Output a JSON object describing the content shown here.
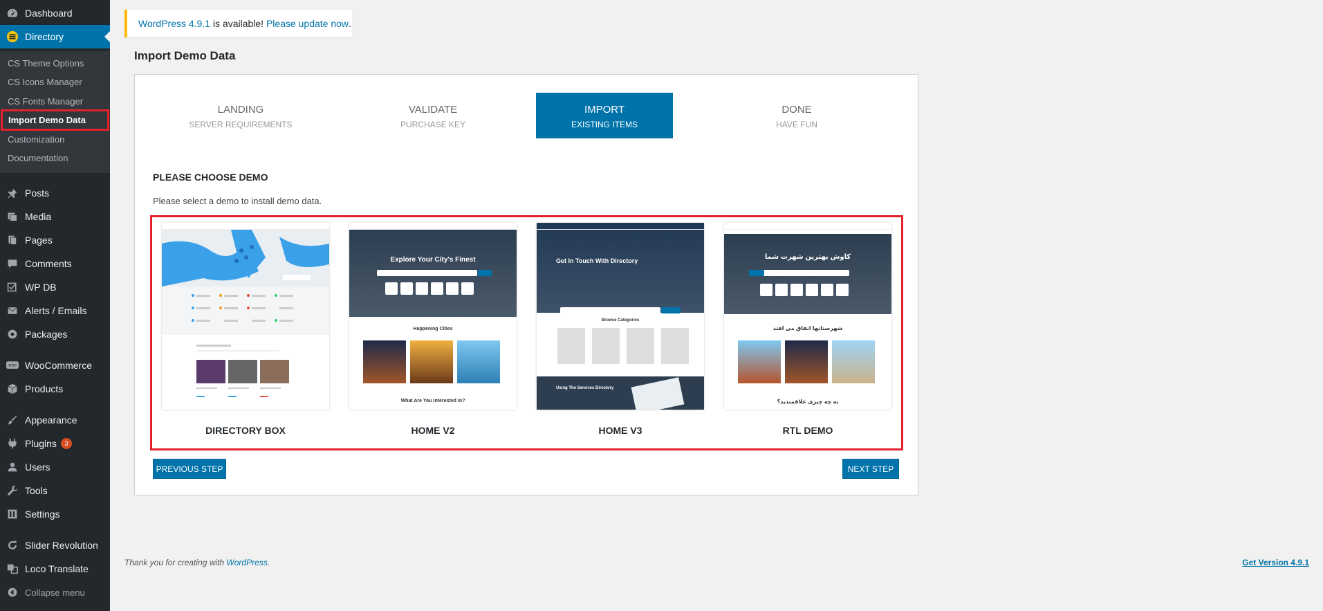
{
  "sidebar": {
    "top": [
      {
        "label": "Dashboard",
        "icon": "dashboard-icon"
      },
      {
        "label": "Directory",
        "icon": "directory-icon"
      }
    ],
    "submenu": [
      {
        "label": "CS Theme Options"
      },
      {
        "label": "CS Icons Manager"
      },
      {
        "label": "CS Fonts Manager"
      },
      {
        "label": "Import Demo Data"
      },
      {
        "label": "Customization"
      },
      {
        "label": "Documentation"
      }
    ],
    "items": [
      {
        "label": "Posts",
        "icon": "pin-icon"
      },
      {
        "label": "Media",
        "icon": "media-icon"
      },
      {
        "label": "Pages",
        "icon": "pages-icon"
      },
      {
        "label": "Comments",
        "icon": "comment-icon"
      },
      {
        "label": "WP DB",
        "icon": "checkbox-icon"
      },
      {
        "label": "Alerts / Emails",
        "icon": "email-icon"
      },
      {
        "label": "Packages",
        "icon": "packages-icon"
      },
      {
        "label": "WooCommerce",
        "icon": "woocommerce-icon"
      },
      {
        "label": "Products",
        "icon": "products-icon"
      },
      {
        "label": "Appearance",
        "icon": "brush-icon"
      },
      {
        "label": "Plugins",
        "icon": "plugin-icon",
        "badge": "3"
      },
      {
        "label": "Users",
        "icon": "user-icon"
      },
      {
        "label": "Tools",
        "icon": "wrench-icon"
      },
      {
        "label": "Settings",
        "icon": "settings-icon"
      },
      {
        "label": "Slider Revolution",
        "icon": "refresh-icon"
      },
      {
        "label": "Loco Translate",
        "icon": "translate-icon"
      }
    ],
    "collapse_label": "Collapse menu"
  },
  "notice": {
    "link1": "WordPress 4.9.1",
    "text": " is available! ",
    "link2": "Please update now",
    "end": "."
  },
  "page_title": "Import Demo Data",
  "steps": [
    {
      "title": "LANDING",
      "sub": "SERVER REQUIREMENTS"
    },
    {
      "title": "VALIDATE",
      "sub": "PURCHASE KEY"
    },
    {
      "title": "IMPORT",
      "sub": "EXISTING ITEMS"
    },
    {
      "title": "DONE",
      "sub": "HAVE FUN"
    }
  ],
  "choose": {
    "title": "PLEASE CHOOSE DEMO",
    "desc": "Please select a demo to install demo data."
  },
  "demos": [
    {
      "label": "DIRECTORY BOX"
    },
    {
      "label": "HOME V2",
      "hero": "Explore Your City's Finest",
      "section": "Happening Cities",
      "footer": "What Are You Interested In?"
    },
    {
      "label": "HOME V3",
      "hero": "Get In Touch With Directory",
      "section": "Browse Categories",
      "footer": "Using The Services Directory"
    },
    {
      "label": "RTL DEMO",
      "hero": "کاوش بهترین شهرت شما",
      "section": "شهرستانها اتفاق می افتد",
      "footer": "به چه چیزی علاقمندید؟"
    }
  ],
  "buttons": {
    "prev": "PREVIOUS STEP",
    "next": "NEXT STEP"
  },
  "footer": {
    "left_text": "Thank you for creating with ",
    "left_link": "WordPress",
    "left_end": ".",
    "right": "Get Version 4.9.1"
  },
  "colors": {
    "accent": "#0073aa",
    "highlight": "#e2212d",
    "sidebar": "#23282d"
  }
}
